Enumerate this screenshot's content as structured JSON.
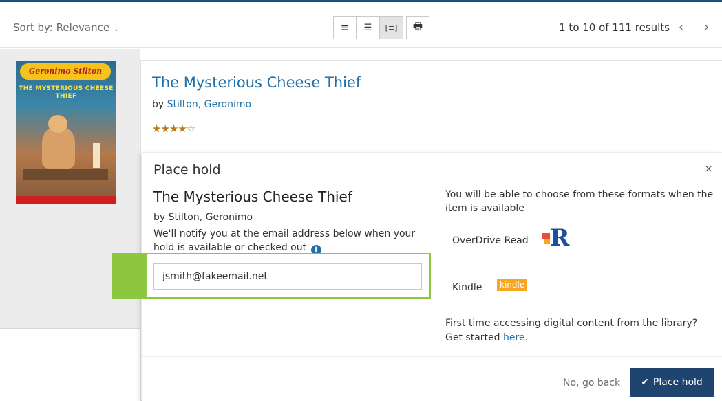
{
  "toolbar": {
    "sort_label": "Sort by: Relevance",
    "view_buttons": [
      {
        "name": "list-view-icon",
        "glyph": "≡"
      },
      {
        "name": "detail-view-icon",
        "glyph": "☰"
      },
      {
        "name": "summary-view-icon",
        "glyph": "[≡]"
      },
      {
        "name": "print-icon",
        "glyph": "🖶"
      }
    ],
    "results_text": "1 to 10 of 111 results",
    "prev_glyph": "‹",
    "next_glyph": "›"
  },
  "cover": {
    "brand": "Geronimo Stilton",
    "title": "THE MYSTERIOUS CHEESE THIEF"
  },
  "result": {
    "title": "The Mysterious Cheese Thief",
    "by_prefix": "by ",
    "author": "Stilton, Geronimo",
    "rating": 4,
    "max_rating": 5
  },
  "hold": {
    "heading": "Place hold",
    "close_glyph": "×",
    "book_title": "The Mysterious Cheese Thief",
    "byline": "by Stilton, Geronimo",
    "note": "We'll notify you at the email address below when your hold is available or checked out",
    "email_value": "jsmith@fakeemail.net",
    "formats_intro": "You will be able to choose from these formats when the item is available",
    "formats": [
      {
        "label": "OverDrive Read",
        "icon": "overdrive-read-icon"
      },
      {
        "label": "Kindle",
        "badge": "kindle"
      }
    ],
    "digital_prefix": "First time accessing digital content from the library? Get started ",
    "digital_link": "here",
    "digital_suffix": ".",
    "go_back": "No, go back",
    "place_hold_label": "Place hold",
    "check_glyph": "✔"
  },
  "colors": {
    "accent_blue": "#1f6fa8",
    "button_navy": "#1f4470",
    "highlight_green": "#8dc63f",
    "star_gold": "#b77a1f",
    "kindle_orange": "#f6a623"
  }
}
